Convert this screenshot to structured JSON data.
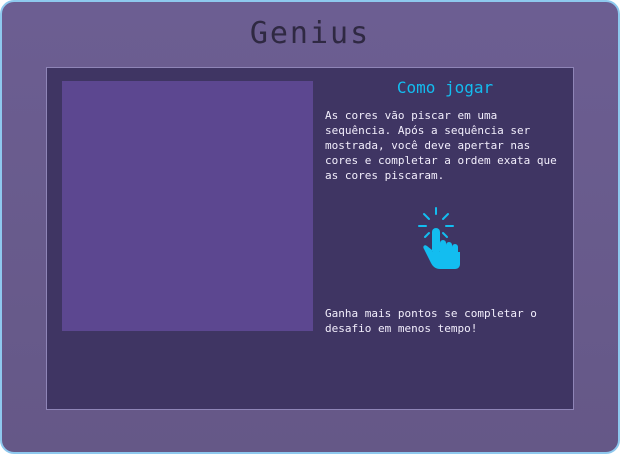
{
  "game": {
    "title": "Genius"
  },
  "instructions": {
    "heading": "Como jogar",
    "paragraph": "As cores vão piscar em uma sequência. Após a sequência ser mostrada, você deve apertar nas cores e completar a ordem exata que as cores piscaram.",
    "bonus": "Ganha mais pontos se completar o desafio em menos tempo!",
    "icon": "tap-hand-icon"
  },
  "colors": {
    "frame_border": "#8ec8ee",
    "frame_background": "#6c5e92",
    "panel_background": "#3f3563",
    "board_background": "#5c4790",
    "accent": "#13bdf0",
    "text": "#f2eefc"
  }
}
